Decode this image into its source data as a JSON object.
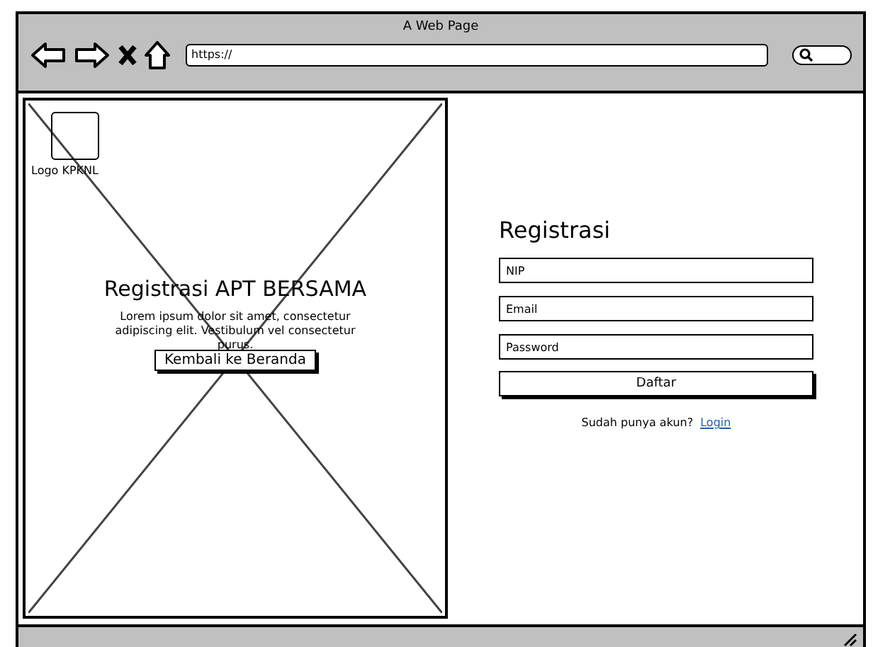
{
  "window": {
    "title": "A Web Page",
    "url": "https://"
  },
  "hero": {
    "logo_label": "Logo KPKNL",
    "title": "Registrasi APT BERSAMA",
    "text": "Lorem ipsum dolor sit amet, consectetur adipiscing elit. Vestibulum vel consectetur purus.",
    "button": "Kembali ke Beranda"
  },
  "form": {
    "title": "Registrasi",
    "fields": [
      {
        "placeholder": "NIP"
      },
      {
        "placeholder": "Email"
      },
      {
        "placeholder": "Password"
      }
    ],
    "submit": "Daftar",
    "prompt": "Sudah punya akun?",
    "link": "Login"
  }
}
